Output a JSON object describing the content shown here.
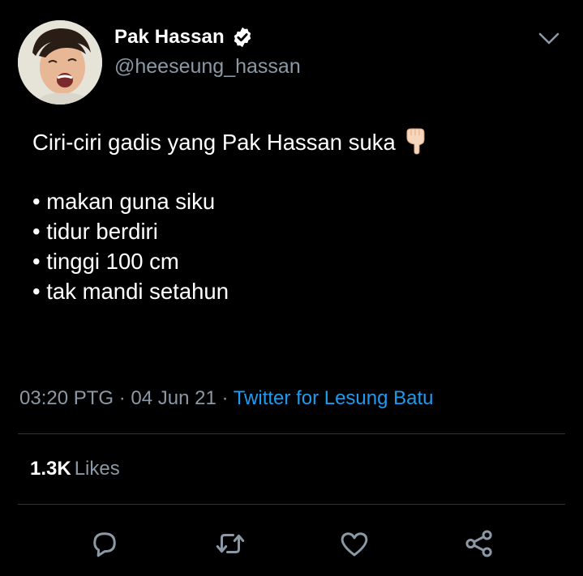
{
  "user": {
    "display_name": "Pak Hassan",
    "handle": "@heeseung_hassan",
    "verified": true
  },
  "tweet": {
    "intro": "Ciri-ciri gadis yang Pak Hassan suka",
    "intro_emoji": "backhand-index-pointing-down-icon",
    "bullets": [
      "• makan guna siku",
      "• tidur berdiri",
      "• tinggi 100 cm",
      "• tak mandi setahun"
    ]
  },
  "meta": {
    "time": "03:20 PTG",
    "separator": " · ",
    "date": "04 Jun 21",
    "source": "Twitter for Lesung Batu"
  },
  "stats": {
    "likes_count": "1.3K",
    "likes_label": "Likes"
  },
  "actions": {
    "reply_icon": "reply-icon",
    "retweet_icon": "retweet-icon",
    "like_icon": "heart-icon",
    "share_icon": "share-icon"
  },
  "colors": {
    "background": "#000000",
    "text_primary": "#ffffff",
    "text_secondary": "#8b98a5",
    "accent": "#1d9bf0",
    "divider": "#2f3336"
  }
}
